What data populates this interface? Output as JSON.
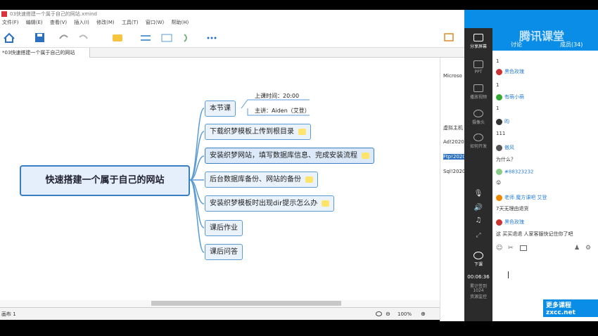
{
  "window": {
    "title": "03快速搭建一个属于自己的网站.xmind"
  },
  "menu": [
    "文件(F)",
    "编辑(E)",
    "查看(V)",
    "插入(I)",
    "修改(M)",
    "工具(T)",
    "窗口(W)",
    "帮助(H)"
  ],
  "tab": {
    "label": "*03快速搭建一个属于自己的网站"
  },
  "mindmap": {
    "root": "快速搭建一个属于自己的网站",
    "branches": [
      "本节课",
      "下载织梦模板上传到根目录",
      "安装织梦网站，填写数据库信息、完成安装流程",
      "后台数据库备份、网站的备份",
      "安装织梦模板时出现dir提示怎么办",
      "课后作业",
      "课后问答"
    ],
    "notes": {
      "time": "上课时间：20:00",
      "teacher": "主讲：Aiden（艾登）"
    }
  },
  "status": {
    "sheet": "画布 1",
    "zoom": "100%"
  },
  "right_panel": {
    "title": "Microso",
    "items": [
      "虚拟主机",
      "Ad!2020",
      "Ftp!2020",
      "Sql!2020"
    ]
  },
  "live": {
    "brand": "腾讯课堂",
    "tabs": {
      "chat": "讨论",
      "members": "成员(34)"
    },
    "sidebar": {
      "share": "分享屏幕",
      "ppt": "PPT",
      "video": "播放视频",
      "camera": "摄像头",
      "whiteboard": "如何开发",
      "end": "下课",
      "timer": "00:06:36",
      "count_label": "累计签到",
      "count": "1024",
      "monitor": "资源监控"
    },
    "chat": [
      {
        "user": "",
        "text": "1"
      },
      {
        "user": "黑色玫瑰",
        "text": ""
      },
      {
        "user": "",
        "text": "1"
      },
      {
        "user": "有萌小萌",
        "text": ""
      },
      {
        "user": "",
        "text": "1"
      },
      {
        "user": "昀",
        "text": ""
      },
      {
        "user": "",
        "text": "111"
      },
      {
        "user": "傲风",
        "text": ""
      },
      {
        "user": "",
        "text": "为什么？"
      },
      {
        "user": "#88323232",
        "text": ""
      },
      {
        "user": "",
        "text": "😜"
      },
      {
        "user": "老师 魔方课吧 艾登",
        "text": ""
      },
      {
        "user": "",
        "text": "7天无理由退货"
      },
      {
        "user": "黑色玫瑰",
        "text": ""
      },
      {
        "user": "",
        "text": "这 买买退退 人家客服快记住你了吧"
      }
    ],
    "watermark": "更多课程 zxcc.net"
  },
  "colors": {
    "node_border": "#5b9bd5",
    "live_blue": "#0a8de6"
  }
}
